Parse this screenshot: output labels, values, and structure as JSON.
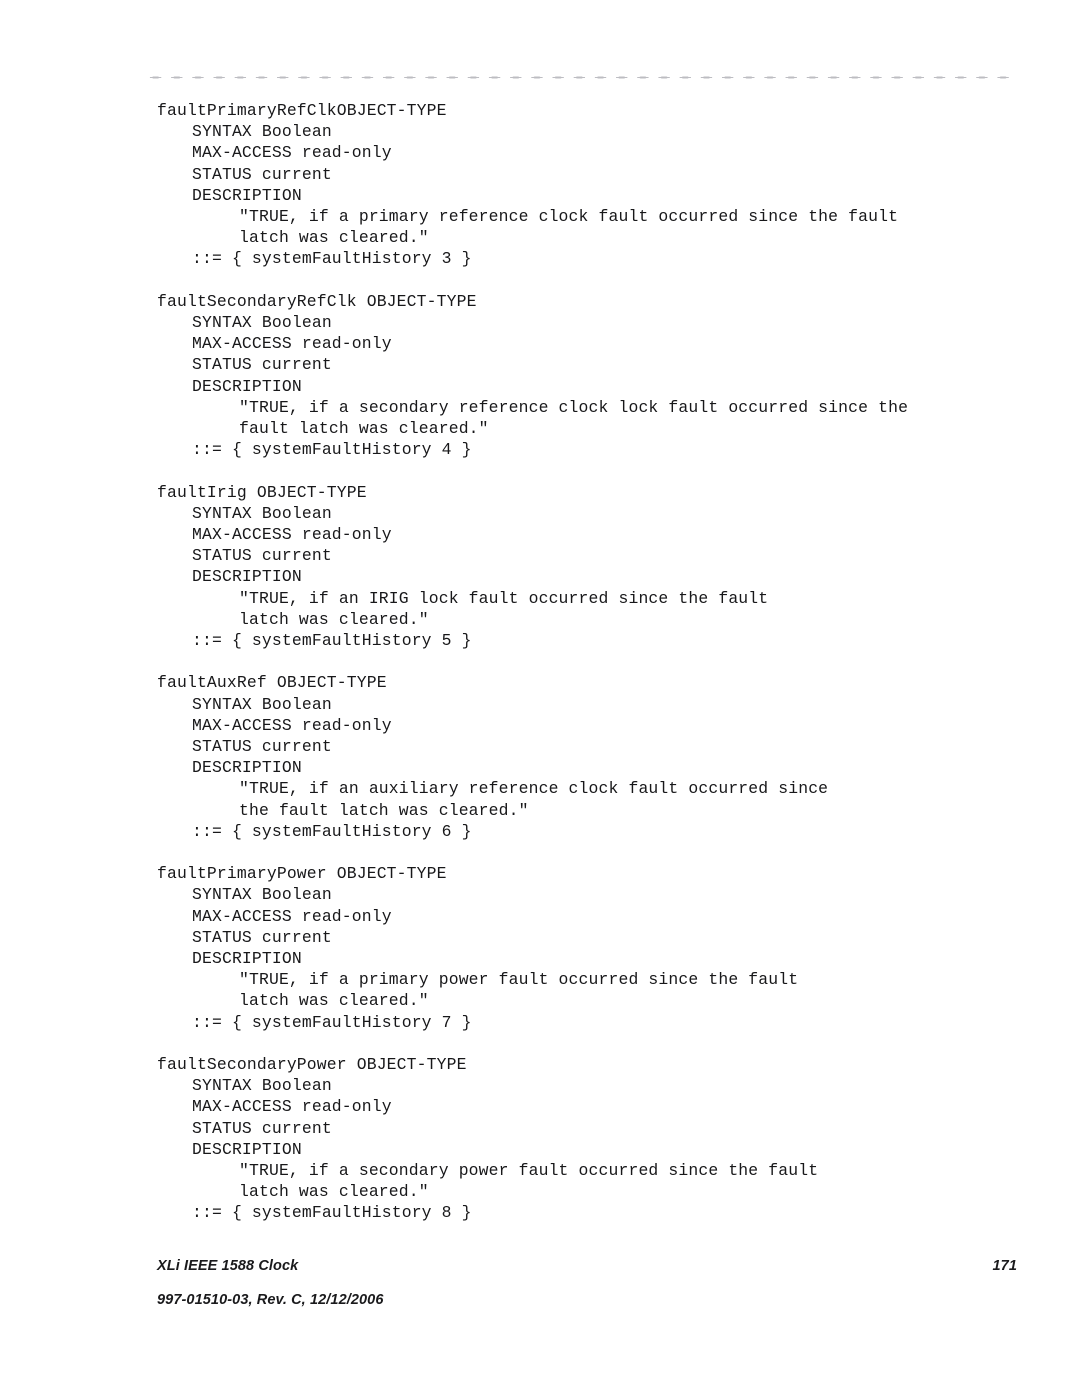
{
  "document": {
    "type": "scanned-technical-manual-page",
    "header_rule": "dotted-rule"
  },
  "code_blocks": [
    {
      "name": "faultPrimaryRefClk",
      "lines": [
        {
          "indent": 0,
          "text": "faultPrimaryRefClkOBJECT-TYPE"
        },
        {
          "indent": 1,
          "text": "SYNTAX Boolean"
        },
        {
          "indent": 1,
          "text": "MAX-ACCESS read-only"
        },
        {
          "indent": 1,
          "text": "STATUS current"
        },
        {
          "indent": 1,
          "text": "DESCRIPTION"
        },
        {
          "indent": 2,
          "text": "\"TRUE, if a primary reference clock fault occurred since the fault"
        },
        {
          "indent": 2,
          "text": "latch was cleared.\""
        },
        {
          "indent": 1,
          "text": "::= { systemFaultHistory 3 }"
        }
      ]
    },
    {
      "name": "faultSecondaryRefClk",
      "lines": [
        {
          "indent": 0,
          "text": "faultSecondaryRefClk OBJECT-TYPE"
        },
        {
          "indent": 1,
          "text": "SYNTAX Boolean"
        },
        {
          "indent": 1,
          "text": "MAX-ACCESS read-only"
        },
        {
          "indent": 1,
          "text": "STATUS current"
        },
        {
          "indent": 1,
          "text": "DESCRIPTION"
        },
        {
          "indent": 2,
          "text": "\"TRUE, if a secondary reference clock lock fault occurred since the"
        },
        {
          "indent": 2,
          "text": "fault latch was cleared.\""
        },
        {
          "indent": 1,
          "text": "::= { systemFaultHistory 4 }"
        }
      ]
    },
    {
      "name": "faultIrig",
      "lines": [
        {
          "indent": 0,
          "text": "faultIrig OBJECT-TYPE"
        },
        {
          "indent": 1,
          "text": "SYNTAX Boolean"
        },
        {
          "indent": 1,
          "text": "MAX-ACCESS read-only"
        },
        {
          "indent": 1,
          "text": "STATUS current"
        },
        {
          "indent": 1,
          "text": "DESCRIPTION"
        },
        {
          "indent": 2,
          "text": "\"TRUE, if an IRIG lock fault occurred since the fault"
        },
        {
          "indent": 2,
          "text": "latch was cleared.\""
        },
        {
          "indent": 1,
          "text": "::= { systemFaultHistory 5 }"
        }
      ]
    },
    {
      "name": "faultAuxRef",
      "lines": [
        {
          "indent": 0,
          "text": "faultAuxRef OBJECT-TYPE"
        },
        {
          "indent": 1,
          "text": "SYNTAX Boolean"
        },
        {
          "indent": 1,
          "text": "MAX-ACCESS read-only"
        },
        {
          "indent": 1,
          "text": "STATUS current"
        },
        {
          "indent": 1,
          "text": "DESCRIPTION"
        },
        {
          "indent": 2,
          "text": "\"TRUE, if an auxiliary reference clock fault occurred since"
        },
        {
          "indent": 2,
          "text": "the fault latch was cleared.\""
        },
        {
          "indent": 1,
          "text": "::= { systemFaultHistory 6 }"
        }
      ]
    },
    {
      "name": "faultPrimaryPower",
      "lines": [
        {
          "indent": 0,
          "text": "faultPrimaryPower OBJECT-TYPE"
        },
        {
          "indent": 1,
          "text": "SYNTAX Boolean"
        },
        {
          "indent": 1,
          "text": "MAX-ACCESS read-only"
        },
        {
          "indent": 1,
          "text": "STATUS current"
        },
        {
          "indent": 1,
          "text": "DESCRIPTION"
        },
        {
          "indent": 2,
          "text": "\"TRUE, if a primary power fault occurred since the fault"
        },
        {
          "indent": 2,
          "text": "latch was cleared.\""
        },
        {
          "indent": 1,
          "text": "::= { systemFaultHistory 7 }"
        }
      ]
    },
    {
      "name": "faultSecondaryPower",
      "lines": [
        {
          "indent": 0,
          "text": "faultSecondaryPower OBJECT-TYPE"
        },
        {
          "indent": 1,
          "text": "SYNTAX Boolean"
        },
        {
          "indent": 1,
          "text": "MAX-ACCESS read-only"
        },
        {
          "indent": 1,
          "text": "STATUS current"
        },
        {
          "indent": 1,
          "text": "DESCRIPTION"
        },
        {
          "indent": 2,
          "text": "\"TRUE, if a secondary power fault occurred since the fault"
        },
        {
          "indent": 2,
          "text": "latch was cleared.\""
        },
        {
          "indent": 1,
          "text": "::= { systemFaultHistory 8 }"
        }
      ]
    }
  ],
  "footer": {
    "doc_title": "XLi IEEE 1588 Clock",
    "page_number": "171",
    "revision": "997-01510-03, Rev. C, 12/12/2006"
  }
}
